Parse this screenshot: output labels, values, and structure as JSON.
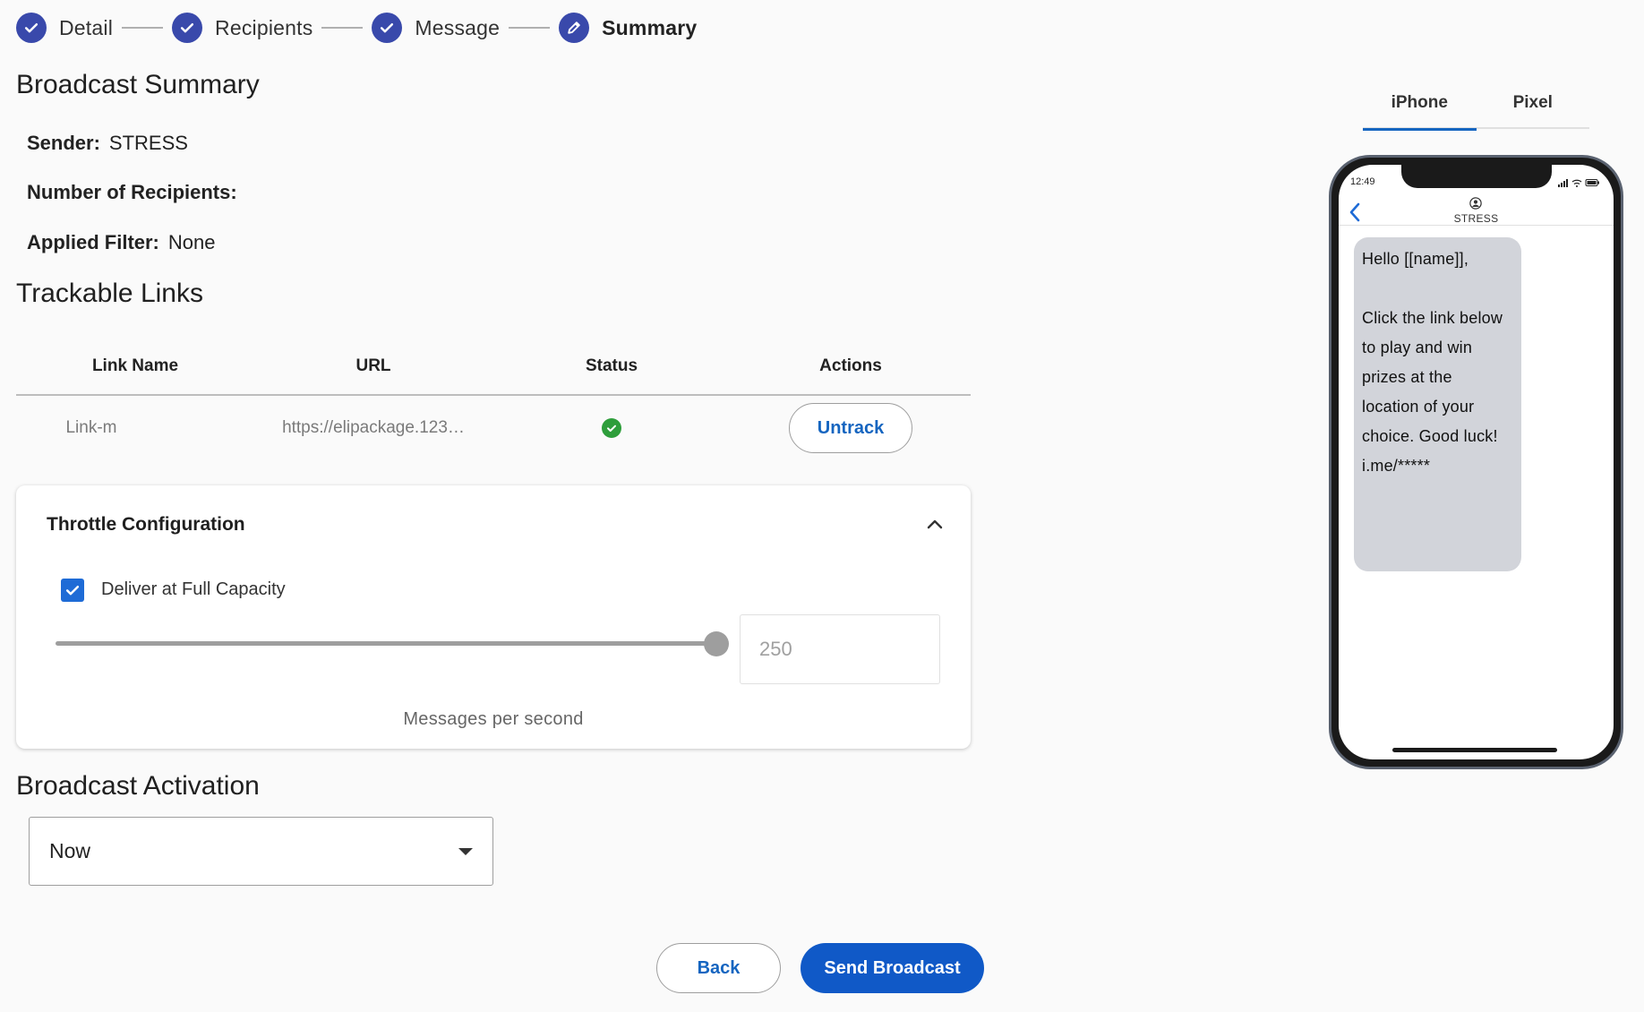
{
  "stepper": {
    "steps": [
      {
        "label": "Detail",
        "state": "done"
      },
      {
        "label": "Recipients",
        "state": "done"
      },
      {
        "label": "Message",
        "state": "done"
      },
      {
        "label": "Summary",
        "state": "active"
      }
    ]
  },
  "summary": {
    "title": "Broadcast Summary",
    "sender_label": "Sender:",
    "sender_value": "STRESS",
    "recipients_label": "Number of Recipients:",
    "recipients_value": "",
    "filter_label": "Applied Filter:",
    "filter_value": "None"
  },
  "links": {
    "title": "Trackable Links",
    "columns": [
      "Link Name",
      "URL",
      "Status",
      "Actions"
    ],
    "rows": [
      {
        "name": "Link-m",
        "url": "https://elipackage.123…",
        "status": "success-icon",
        "action": "Untrack"
      }
    ]
  },
  "throttle": {
    "title": "Throttle Configuration",
    "checkbox_label": "Deliver at Full Capacity",
    "checked": true,
    "slider_fraction": 1.0,
    "rate_value": "250",
    "caption": "Messages per second"
  },
  "activation": {
    "title": "Broadcast Activation",
    "selected": "Now"
  },
  "buttons": {
    "back": "Back",
    "send": "Send Broadcast"
  },
  "preview": {
    "tabs": [
      "iPhone",
      "Pixel"
    ],
    "active_tab": "iPhone",
    "time": "12:49",
    "contact": "STRESS",
    "message": "Hello [[name]],\n\nClick the link below to play and win prizes at the location of your choice. Good luck!\ni.me/*****"
  },
  "colors": {
    "accent": "#1565c0",
    "primary_button": "#1059c7",
    "step_icon": "#3949ab",
    "success": "#2e9e3b",
    "checkbox": "#1e6bd6"
  }
}
